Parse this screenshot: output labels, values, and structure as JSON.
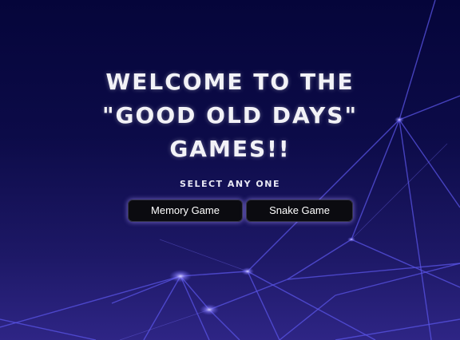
{
  "page": {
    "title_line1": "WELCOME TO THE",
    "title_line2": "\"GOOD OLD DAYS\"",
    "title_line3": "GAMES!!",
    "subtitle": "SELECT ANY ONE"
  },
  "buttons": {
    "memory": "Memory Game",
    "snake": "Snake Game"
  },
  "colors": {
    "background_top": "#05053a",
    "background_bottom": "#2e2585",
    "network_lines": "#5a54e6",
    "button_bg": "#0b0b10",
    "button_glow": "#aa96ff"
  }
}
